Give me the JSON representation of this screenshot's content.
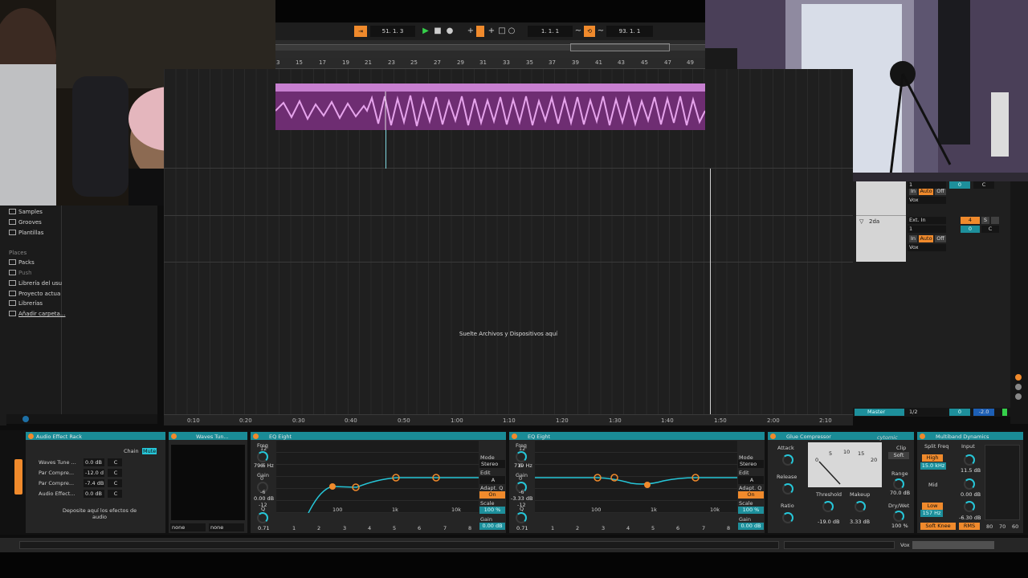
{
  "transport": {
    "position": "51.  1.  3",
    "loop_start": "1.  1.  1",
    "loop_length": "93.  1.  1"
  },
  "ruler": {
    "beats": [
      "3",
      "15",
      "17",
      "19",
      "21",
      "23",
      "25",
      "27",
      "29",
      "31",
      "33",
      "35",
      "37",
      "39",
      "41",
      "43",
      "45",
      "47",
      "49"
    ]
  },
  "timeline": {
    "labels": [
      "0:10",
      "0:20",
      "0:30",
      "0:40",
      "0:50",
      "1:00",
      "1:10",
      "1:20",
      "1:30",
      "1:40",
      "1:50",
      "2:00",
      "2:10"
    ]
  },
  "arrangement": {
    "drop_text": "Suelte Archivos y Dispositivos aquí"
  },
  "browser": {
    "items": [
      "Samples",
      "Grooves",
      "Plantillas"
    ],
    "places_header": "Places",
    "places": [
      "Packs",
      "Push",
      "Librería del usu",
      "Proyecto actua",
      "Librerías",
      "Añadir carpeta..."
    ]
  },
  "mixer": {
    "track1": {
      "in": "In",
      "auto": "Auto",
      "off": "Off",
      "input": "Vox",
      "channel": "1",
      "vol": "0",
      "pan": "C"
    },
    "track2": {
      "name": "2da",
      "input_type": "Ext. In",
      "channel": "1",
      "in": "In",
      "auto": "Auto",
      "off": "Off",
      "input": "Vox",
      "num": "4",
      "s": "S",
      "vol": "0",
      "pan": "C"
    },
    "master": {
      "name": "Master",
      "route": "1/2",
      "vol": "0",
      "gain": "-2.0"
    }
  },
  "devices": {
    "rack": {
      "title": "Audio Effect Rack",
      "chain_label": "Chain",
      "mute_label": "Mute",
      "chains": [
        {
          "name": "Waves Tune ...",
          "vol": "0.0 dB",
          "pan": "C"
        },
        {
          "name": "Par Compre...",
          "vol": "-12.0 d",
          "pan": "C"
        },
        {
          "name": "Par Compre...",
          "vol": "-7.4 dB",
          "pan": "C"
        },
        {
          "name": "Audio Effect...",
          "vol": "0.0 dB",
          "pan": "C"
        }
      ],
      "drop_text": "Deposite aquí los efectos de audio"
    },
    "waves": {
      "title": "Waves Tun...",
      "sel1": "none",
      "sel2": "none"
    },
    "eq1": {
      "title": "EQ Eight",
      "freq_label": "Freq",
      "freq": "79.6 Hz",
      "gain_label": "Gain",
      "gain": "0.00 dB",
      "q_label": "Q",
      "q": "0.71",
      "mode_label": "Mode",
      "mode": "Stereo",
      "edit_label": "Edit",
      "edit_val": "A",
      "adaptq_label": "Adapt. Q",
      "adaptq": "On",
      "scale_label": "Scale",
      "scale": "100 %",
      "gain2_label": "Gain",
      "gain2": "0.00 dB",
      "grid_y": [
        "12",
        "6",
        "0",
        "-6",
        "-12"
      ],
      "grid_x": [
        "100",
        "1k",
        "10k"
      ],
      "bands": [
        "1",
        "2",
        "3",
        "4",
        "5",
        "6",
        "7",
        "8"
      ]
    },
    "eq2": {
      "title": "EQ Eight",
      "freq_label": "Freq",
      "freq": "719 Hz",
      "gain_label": "Gain",
      "gain": "-3.33 dB",
      "q_label": "Q",
      "q": "0.71",
      "mode_label": "Mode",
      "mode": "Stereo",
      "edit_label": "Edit",
      "edit_val": "A",
      "adaptq_label": "Adapt. Q",
      "adaptq": "On",
      "scale_label": "Scale",
      "scale": "100 %",
      "gain2_label": "Gain",
      "gain2": "0.00 dB",
      "grid_y": [
        "12",
        "6",
        "0",
        "-6",
        "-12"
      ],
      "grid_x": [
        "100",
        "1k",
        "10k"
      ],
      "bands": [
        "1",
        "2",
        "3",
        "4",
        "5",
        "6",
        "7",
        "8"
      ]
    },
    "glue": {
      "title": "Glue Compressor",
      "brand": "cytomic",
      "attack_label": "Attack",
      "release_label": "Release",
      "ratio_label": "Ratio",
      "threshold_label": "Threshold",
      "threshold": "-19.0 dB",
      "makeup_label": "Makeup",
      "makeup": "3.33 dB",
      "clip_label": "Clip",
      "soft_label": "Soft",
      "range_label": "Range",
      "range": "70.0 dB",
      "drywet_label": "Dry/Wet",
      "drywet": "100 %",
      "meter_scale": [
        "0",
        "5",
        "10",
        "15",
        "20"
      ]
    },
    "multiband": {
      "title": "Multiband Dynamics",
      "split_label": "Split Freq",
      "input_label": "Input",
      "high_label": "High",
      "high_freq": "15.0 kHz",
      "high_in": "11.5 dB",
      "mid_label": "Mid",
      "mid_in": "0.00 dB",
      "low_label": "Low",
      "low_freq": "157 Hz",
      "low_in": "-6.30 dB",
      "softknee_label": "Soft Knee",
      "rms_label": "RMS",
      "meter_scale": [
        "80",
        "70",
        "60"
      ]
    }
  },
  "statusbar": {
    "track_label": "Vox"
  },
  "colors": {
    "accent": "#f08a2c",
    "device_header": "#1a8b96",
    "clip": "#c77fd0",
    "eq_curve": "#26c6d8"
  }
}
